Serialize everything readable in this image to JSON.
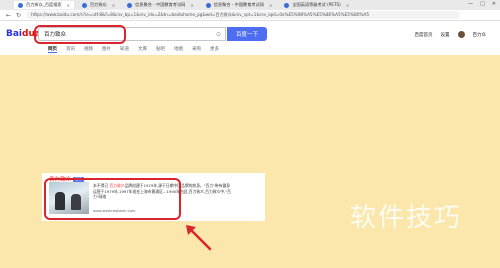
{
  "browser": {
    "tabs": [
      {
        "label": "百力致众_百度搜索",
        "active": true
      },
      {
        "label": "百力致众",
        "active": false
      },
      {
        "label": "信息聚合 - 中国教育考试网",
        "active": false
      },
      {
        "label": "信息聚合 - 中国教育考试网",
        "active": false
      },
      {
        "label": "全国英语等级考试 (PETS)",
        "active": false
      }
    ],
    "address": "https://www.baidu.com/s?ie=utf-8&f=8&rsv_bp=1&rsv_idx=2&tn=baiduhome_pg&wd=百力致众&rsv_spt=1&rsv_iqid=0x%E5%98%A5%E5%8E%A5%E5%B0%A5",
    "window_buttons": [
      "—",
      "□",
      "✕"
    ]
  },
  "search": {
    "logo_black": "Bai",
    "logo_red": "du",
    "logo_cn": "百度",
    "query": "百力致众",
    "button_label": "百度一下",
    "user_links": [
      "百度首页",
      "设置",
      "百力众"
    ],
    "tabs": [
      "网页",
      "资讯",
      "视频",
      "图片",
      "知道",
      "文库",
      "贴吧",
      "地图",
      "采购",
      "更多"
    ]
  },
  "result": {
    "title_prefix": "百力致众",
    "badge": "官方",
    "snippet_lead": "本不得已",
    "snippet_hl": "百力致众",
    "snippet_rest": "品牌创建于1979年,源于日期中国品牌的前身。\"百力\"带有健身运营于1979年,1997年现在上海市黄浦区...1990年由此,百力致众,百力致众中,\"百力\"网络",
    "source": "www.werkrealsean.com"
  },
  "watermark": "软件技巧",
  "colors": {
    "page_bg": "#fbe7ab",
    "annotation_red": "#d9252b",
    "baidu_blue": "#4e6ef2",
    "link_blue": "#2440b3",
    "highlight_red": "#f73131"
  }
}
